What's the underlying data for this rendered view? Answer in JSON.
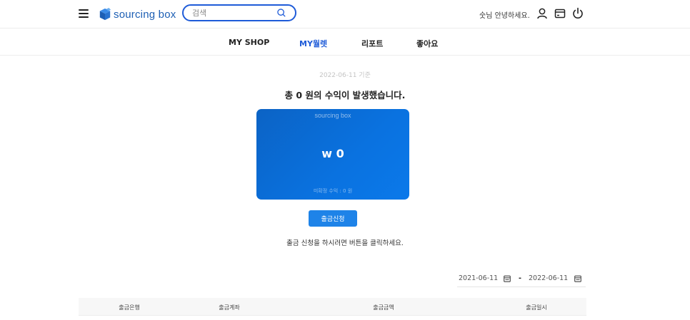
{
  "header": {
    "logo_text": "sourcing box",
    "search_placeholder": "검색",
    "greeting": "숫님 안녕하세요."
  },
  "nav": {
    "items": [
      {
        "label": "MY SHOP",
        "active": false
      },
      {
        "label": "MY월렛",
        "active": true
      },
      {
        "label": "리포트",
        "active": false
      },
      {
        "label": "좋아요",
        "active": false
      }
    ]
  },
  "wallet": {
    "date_basis": "2022-06-11 기준",
    "summary": "총 0 원의 수익이 발생했습니다.",
    "card_brand": "sourcing box",
    "card_amount": "w 0",
    "card_pending": "미확정 수익 : 0 원",
    "withdraw_button": "출금신청",
    "hint": "출금 신청을 하시려면 버튼을 클릭하세요."
  },
  "date_range": {
    "start": "2021-06-11",
    "separator": "-",
    "end": "2022-06-11"
  },
  "table": {
    "columns": [
      "출금은행",
      "출금계좌",
      "출금금액",
      "출금일시"
    ]
  },
  "colors": {
    "accent": "#1e5bd8",
    "card": "#0a72e0",
    "button": "#1e83e8"
  },
  "icons": [
    "menu-icon",
    "logo-box-icon",
    "search-icon",
    "user-icon",
    "wallet-icon",
    "power-icon",
    "calendar-icon"
  ]
}
